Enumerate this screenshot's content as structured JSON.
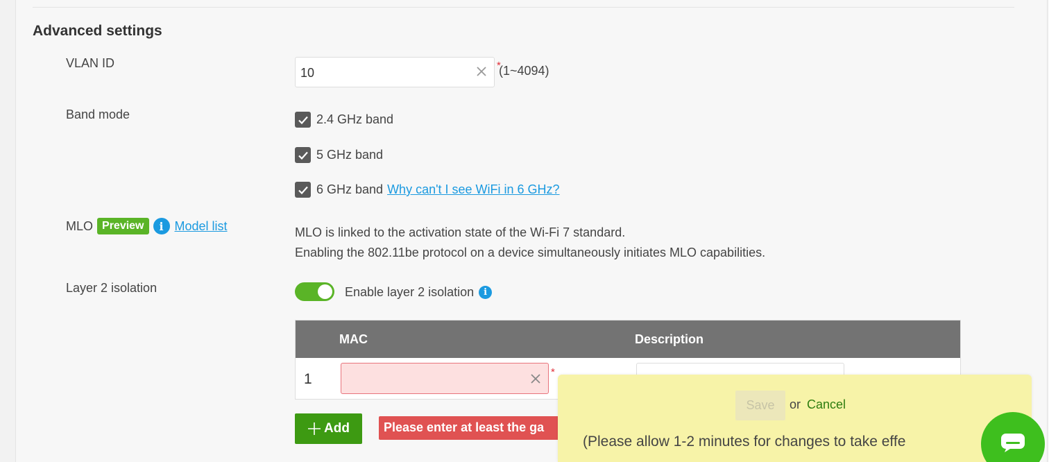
{
  "section": {
    "title": "Advanced settings"
  },
  "vlan": {
    "label": "VLAN ID",
    "value": "10",
    "required_mark": "*",
    "range_hint": "(1~4094)"
  },
  "band_mode": {
    "label": "Band mode",
    "options": [
      {
        "label": "2.4 GHz band",
        "checked": true
      },
      {
        "label": "5 GHz band",
        "checked": true
      },
      {
        "label": "6 GHz band",
        "checked": true,
        "link": "Why can't I see WiFi in 6 GHz?"
      }
    ]
  },
  "mlo": {
    "label": "MLO",
    "badge": "Preview",
    "info_icon": "info-icon",
    "model_list_link": "Model list",
    "desc_line1": "MLO is linked to the activation state of the Wi-Fi 7 standard.",
    "desc_line2": "Enabling the 802.11be protocol on a device simultaneously initiates MLO capabilities."
  },
  "layer2": {
    "label": "Layer 2 isolation",
    "toggle_on": true,
    "toggle_label": "Enable layer 2 isolation",
    "table": {
      "headers": {
        "mac": "MAC",
        "description": "Description"
      },
      "rows": [
        {
          "index": "1",
          "mac": "",
          "description": ""
        }
      ],
      "required_mark": "*"
    },
    "add_button": "Add",
    "error_text": "Please enter at least the ga"
  },
  "save_bar": {
    "save_label": "Save",
    "or_text": "or",
    "cancel_label": "Cancel",
    "note": "(Please allow 1-2 minutes for changes to take effe"
  },
  "colors": {
    "accent_green": "#5ab427",
    "button_green": "#3d9a12",
    "link_blue": "#1b9ae0",
    "error_red": "#e05252",
    "header_gray": "#737373",
    "save_bar_yellow": "#f7f3a8"
  }
}
